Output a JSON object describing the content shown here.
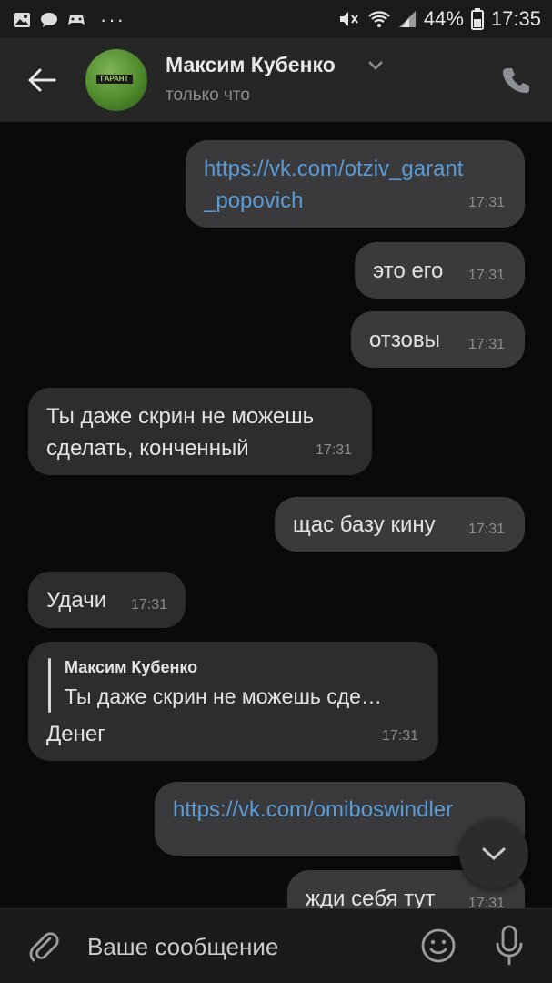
{
  "status_bar": {
    "battery": "44%",
    "time": "17:35",
    "dots": "···",
    "icons": [
      "image-icon",
      "chat-bubble-icon",
      "game-icon",
      "mute-icon",
      "wifi-icon",
      "signal-icon",
      "battery-icon"
    ]
  },
  "header": {
    "contact_name": "Максим Кубенко",
    "subtitle": "только что",
    "avatar_text": "ГАРАНТ"
  },
  "messages": [
    {
      "side": "out",
      "link": true,
      "lines": [
        "https://vk.com/otziv_garant",
        "_popovich"
      ],
      "time": "17:31"
    },
    {
      "side": "out",
      "lines": [
        "это его"
      ],
      "time": "17:31"
    },
    {
      "side": "out",
      "lines": [
        "отзовы"
      ],
      "time": "17:31"
    },
    {
      "side": "in",
      "lines": [
        "Ты даже скрин не можешь",
        "сделать, конченный"
      ],
      "time": "17:31"
    },
    {
      "side": "out",
      "lines": [
        "щас базу кину"
      ],
      "time": "17:31"
    },
    {
      "side": "in",
      "lines": [
        "Удачи"
      ],
      "time": "17:31"
    },
    {
      "side": "in",
      "reply_name": "Максим Кубенко",
      "reply_text": "Ты даже скрин не можешь сде…",
      "lines": [
        "Денег"
      ],
      "time": "17:31"
    },
    {
      "side": "out",
      "link": true,
      "lines": [
        "https://vk.com/omiboswindler"
      ],
      "time": ""
    },
    {
      "side": "out",
      "lines": [
        "жди себя тут"
      ],
      "time": "17:31"
    }
  ],
  "composer": {
    "placeholder": "Ваше сообщение"
  },
  "colors": {
    "background": "#0a0a0a",
    "header": "#262626",
    "bubble_in": "#2d2d2f",
    "bubble_out": "#3a3a3c",
    "link": "#5b9bd5"
  }
}
